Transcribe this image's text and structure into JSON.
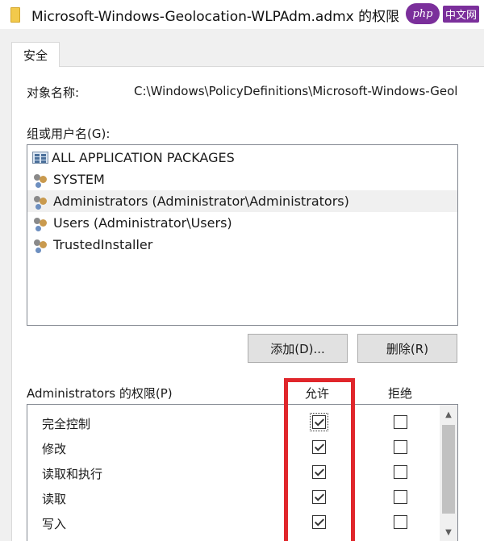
{
  "window": {
    "title": "Microsoft-Windows-Geolocation-WLPAdm.admx 的权限"
  },
  "watermark": {
    "logo": "php",
    "text": "中文网"
  },
  "tabs": [
    {
      "label": "安全"
    }
  ],
  "object": {
    "label": "对象名称:",
    "value": "C:\\Windows\\PolicyDefinitions\\Microsoft-Windows-Geolocation-WLPAdm.admx"
  },
  "groups": {
    "label": "组或用户名(G):",
    "items": [
      {
        "name": "ALL APPLICATION PACKAGES",
        "icon": "package-icon"
      },
      {
        "name": "SYSTEM",
        "icon": "users-icon"
      },
      {
        "name": "Administrators (Administrator\\Administrators)",
        "icon": "users-icon",
        "selected": true
      },
      {
        "name": "Users (Administrator\\Users)",
        "icon": "users-icon"
      },
      {
        "name": "TrustedInstaller",
        "icon": "users-icon"
      }
    ]
  },
  "buttons": {
    "add": "添加(D)...",
    "remove": "删除(R)"
  },
  "permissions": {
    "title": "Administrators 的权限(P)",
    "allow_header": "允许",
    "deny_header": "拒绝",
    "rows": [
      {
        "name": "完全控制",
        "allow": true,
        "deny": false
      },
      {
        "name": "修改",
        "allow": true,
        "deny": false
      },
      {
        "name": "读取和执行",
        "allow": true,
        "deny": false
      },
      {
        "name": "读取",
        "allow": true,
        "deny": false
      },
      {
        "name": "写入",
        "allow": true,
        "deny": false
      }
    ]
  },
  "colors": {
    "highlight": "#e0262b",
    "selection": "#f0f0f0"
  }
}
